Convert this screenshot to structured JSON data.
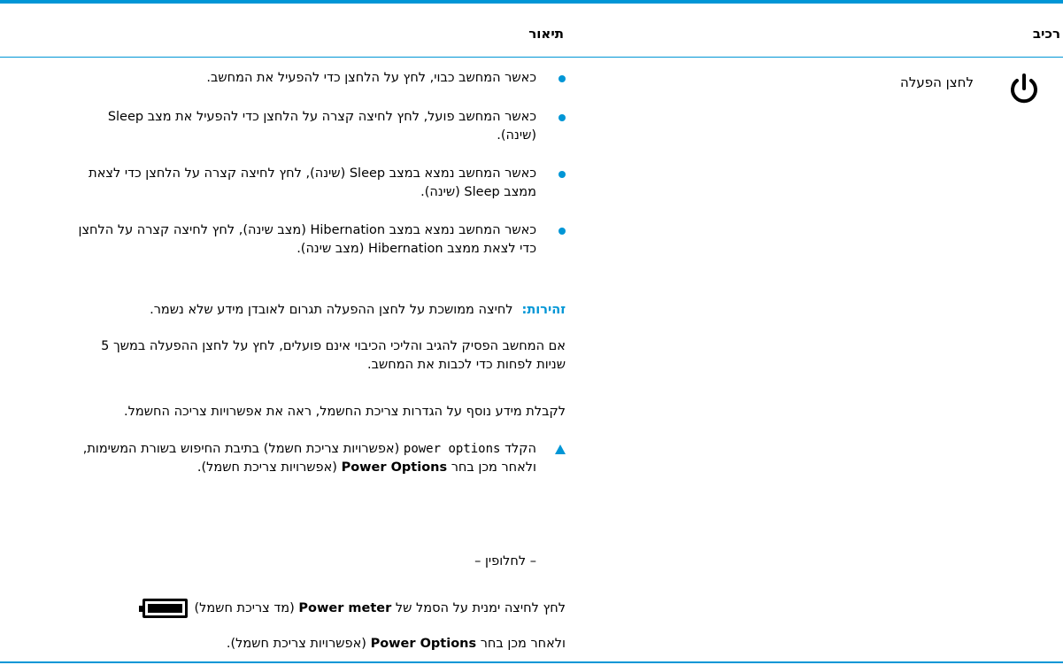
{
  "table": {
    "header_component": "רכיב",
    "header_description": "תיאור"
  },
  "component": {
    "icon": "power-icon",
    "name": "לחצן הפעלה"
  },
  "bullets": [
    "כאשר המחשב כבוי, לחץ על הלחצן כדי להפעיל את המחשב.",
    "כאשר המחשב פועל, לחץ לחיצה קצרה על הלחצן כדי להפעיל את מצב Sleep (שינה).",
    "כאשר המחשב נמצא במצב Sleep (שינה), לחץ לחיצה קצרה על הלחצן כדי לצאת ממצב Sleep (שינה).",
    "כאשר המחשב נמצא במצב Hibernation (מצב שינה), לחץ לחיצה קצרה על הלחצן כדי לצאת ממצב Hibernation (מצב שינה)."
  ],
  "warning": {
    "label": "זהירות:",
    "text": "לחיצה ממושכת על לחצן ההפעלה תגרום לאובדן מידע שלא נשמר."
  },
  "paragraphs": {
    "unresponsive": "אם המחשב הפסיק להגיב והליכי הכיבוי אינם פועלים, לחץ על לחצן ההפעלה במשך 5 שניות לפחות כדי לכבות את המחשב.",
    "more_info": "לקבלת מידע נוסף על הגדרות צריכת החשמל, ראה את אפשרויות צריכה החשמל."
  },
  "step": {
    "prefix": "הקלד",
    "code": "power options",
    "middle": "(אפשרויות צריכת חשמל) בתיבת החיפוש בשורת המשימות, ולאחר מכן בחר",
    "bold": "Power Options",
    "suffix": "(אפשרויות צריכת חשמל)."
  },
  "alternative": "– לחלופין –",
  "right_click": {
    "prefix": "לחץ לחיצה ימנית על הסמל של",
    "bold": "Power meter",
    "suffix": "(מד צריכת חשמל)",
    "icon": "battery-icon"
  },
  "then_choose": {
    "prefix": "ולאחר מכן בחר",
    "bold": "Power Options",
    "suffix": "(אפשרויות צריכת חשמל)."
  },
  "colors": {
    "accent": "#0096d6",
    "text": "#000000"
  }
}
